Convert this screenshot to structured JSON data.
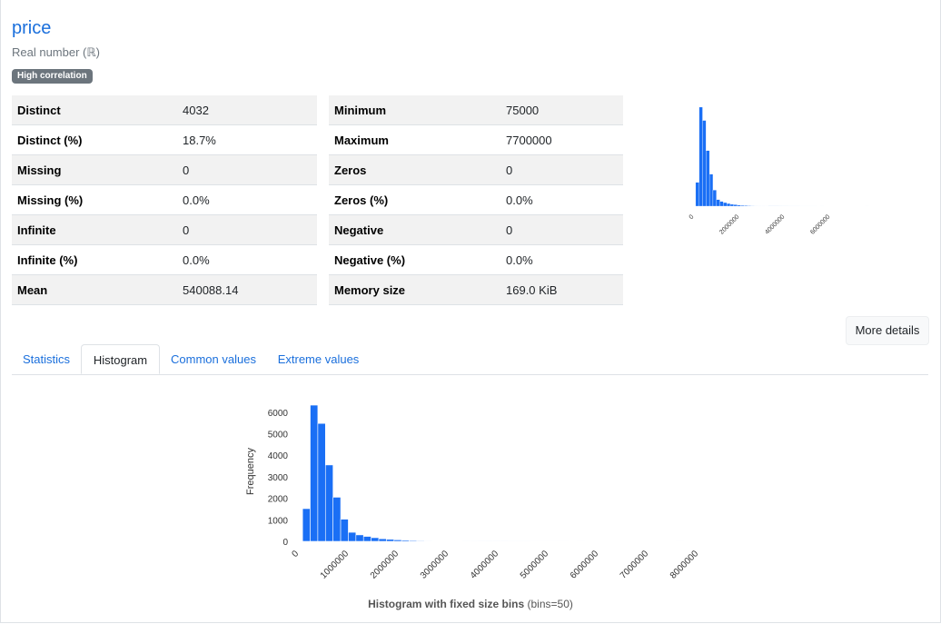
{
  "variable": {
    "name": "price",
    "type": "Real number (ℝ)",
    "badge": "High correlation"
  },
  "stats_left": [
    {
      "key": "Distinct",
      "value": "4032"
    },
    {
      "key": "Distinct (%)",
      "value": "18.7%"
    },
    {
      "key": "Missing",
      "value": "0"
    },
    {
      "key": "Missing (%)",
      "value": "0.0%"
    },
    {
      "key": "Infinite",
      "value": "0"
    },
    {
      "key": "Infinite (%)",
      "value": "0.0%"
    },
    {
      "key": "Mean",
      "value": "540088.14"
    }
  ],
  "stats_right": [
    {
      "key": "Minimum",
      "value": "75000"
    },
    {
      "key": "Maximum",
      "value": "7700000"
    },
    {
      "key": "Zeros",
      "value": "0"
    },
    {
      "key": "Zeros (%)",
      "value": "0.0%"
    },
    {
      "key": "Negative",
      "value": "0"
    },
    {
      "key": "Negative (%)",
      "value": "0.0%"
    },
    {
      "key": "Memory size",
      "value": "169.0 KiB"
    }
  ],
  "more_details_label": "More details",
  "tabs": [
    {
      "label": "Statistics",
      "active": false
    },
    {
      "label": "Histogram",
      "active": true
    },
    {
      "label": "Common values",
      "active": false
    },
    {
      "label": "Extreme values",
      "active": false
    }
  ],
  "histogram_caption": {
    "title": "Histogram with fixed size bins",
    "detail": "(bins=50)"
  },
  "colors": {
    "bar": "#1a6ff5",
    "link": "#1a6fdc"
  },
  "chart_data": [
    {
      "type": "bar",
      "title": "",
      "x_ticks": [
        "0",
        "2000000",
        "4000000",
        "6000000"
      ],
      "bin_range": [
        75000,
        7700000
      ],
      "bins": 50,
      "values": [
        1520,
        6330,
        5480,
        3550,
        2050,
        1030,
        420,
        300,
        230,
        170,
        120,
        95,
        70,
        52,
        40,
        30,
        24,
        18,
        14,
        11,
        9,
        7,
        6,
        5,
        4,
        3,
        3,
        2,
        2,
        2,
        1,
        1,
        1,
        1,
        1,
        0,
        1,
        0,
        0,
        0,
        0,
        0,
        0,
        0,
        0,
        0,
        0,
        0,
        0,
        1
      ],
      "ylim": [
        0,
        6500
      ],
      "xlim": [
        0,
        8000000
      ]
    },
    {
      "type": "bar",
      "title": "",
      "xlabel": "",
      "ylabel": "Frequency",
      "x_ticks": [
        "0",
        "1000000",
        "2000000",
        "3000000",
        "4000000",
        "5000000",
        "6000000",
        "7000000",
        "8000000"
      ],
      "y_ticks": [
        "0",
        "1000",
        "2000",
        "3000",
        "4000",
        "5000",
        "6000"
      ],
      "bin_range": [
        75000,
        7700000
      ],
      "bins": 50,
      "values": [
        1520,
        6330,
        5480,
        3550,
        2050,
        1030,
        420,
        300,
        230,
        170,
        120,
        95,
        70,
        52,
        40,
        30,
        24,
        18,
        14,
        11,
        9,
        7,
        6,
        5,
        4,
        3,
        3,
        2,
        2,
        2,
        1,
        1,
        1,
        1,
        1,
        0,
        1,
        0,
        0,
        0,
        0,
        0,
        0,
        0,
        0,
        0,
        0,
        0,
        0,
        1
      ],
      "ylim": [
        0,
        6500
      ],
      "xlim": [
        0,
        8000000
      ]
    }
  ]
}
